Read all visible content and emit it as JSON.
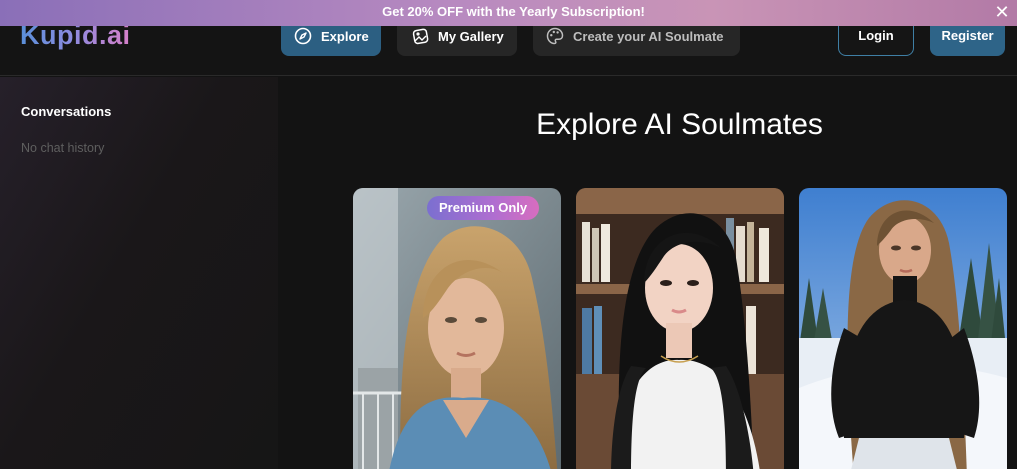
{
  "promo": {
    "text": "Get 20% OFF with the Yearly Subscription!"
  },
  "header": {
    "logo": "Kupid.ai",
    "nav": [
      {
        "label": "Explore",
        "icon": "compass-icon",
        "active": true
      },
      {
        "label": "My Gallery",
        "icon": "gallery-icon",
        "active": false
      },
      {
        "label": "Create your AI Soulmate",
        "icon": "palette-icon",
        "active": false
      }
    ],
    "login_label": "Login",
    "register_label": "Register"
  },
  "sidebar": {
    "title": "Conversations",
    "empty_text": "No chat history"
  },
  "main": {
    "title": "Explore AI Soulmates",
    "cards": [
      {
        "badge": "Premium Only",
        "image": "portrait-blonde-woman-balcony"
      },
      {
        "badge": "",
        "image": "portrait-dark-haired-woman-bookshelf"
      },
      {
        "badge": "",
        "image": "portrait-woman-snowy-forest"
      }
    ]
  },
  "colors": {
    "background": "#131313",
    "accent": "#2c5f82",
    "promo_gradient_start": "#8a6fb8",
    "promo_gradient_end": "#b27aa6"
  }
}
